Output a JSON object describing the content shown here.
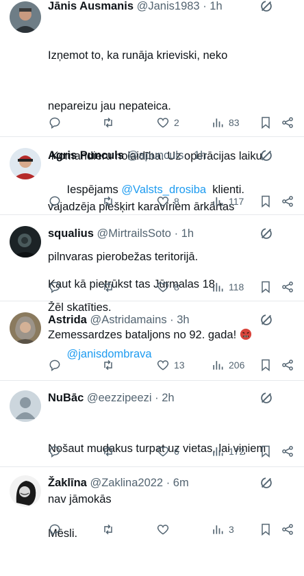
{
  "tweets": [
    {
      "name": "Jānis Ausmanis",
      "handle": "@Janis1983",
      "time": "· 1h",
      "lines": [
        "Izņemot to, ka runāja krieviski, neko",
        "nepareizu jau nepateica.",
        " Komandieru nolaidība. Uz operācijas laiku",
        "vajadzēja piešķirt karavīriem ārkārtas",
        "pilnvaras pierobežas teritorijā.",
        "Žēl skatīties."
      ],
      "likes": "2",
      "views": "83",
      "avatar_colors": {
        "bg": "#6e7d86",
        "skin": "#c89a80",
        "shirt": "#2c3338"
      }
    },
    {
      "name": "Agris Punculs",
      "handle": "@apunculs",
      "time": "· 1h",
      "text_prefix": "Iespējams ",
      "mention": "@Valsts_drosiba",
      "text_suffix": "  klienti.",
      "likes": "8",
      "views": "117",
      "avatar_colors": {
        "bg": "#dfe8f0",
        "skin": "#d7a98c",
        "shirt": "#b52b2b"
      }
    },
    {
      "name": "squalius",
      "handle": "@MirtrailsSoto",
      "time": "· 1h",
      "lines": [
        "Kaut kā pietrūkst tas Jūrmalas 18.",
        "Zemessardzes bataljons no 92. gada! "
      ],
      "emoji": "angry-face",
      "likes": "8",
      "views": "118",
      "avatar_colors": {
        "bg": "#1c2326",
        "skin": "#4a5a5c",
        "shirt": "#0e1214"
      }
    },
    {
      "name": "Astrida",
      "handle": "@Astridamains",
      "time": "· 3h",
      "mention_line": "@janisdombrava",
      "likes": "13",
      "views": "206",
      "avatar_colors": {
        "bg": "#8a7a5e",
        "skin": "#d4b196",
        "shirt": "#5a5246"
      }
    },
    {
      "name": "NuBāc",
      "handle": "@eezzipeezi",
      "time": "· 2h",
      "lines": [
        "Nošaut mudakus turpat uz vietas, lai viņiem",
        "nav jāmokās"
      ],
      "likes": "6",
      "views": "172",
      "avatar_colors": {
        "bg": "#ccd6dd",
        "skin": "#8a98a2",
        "shirt": "#8a98a2"
      }
    },
    {
      "name": "Žaklīna",
      "handle": "@Zaklina2022",
      "time": "· 6m",
      "lines": [
        "Mēsli."
      ],
      "likes": "",
      "views": "3",
      "avatar_colors": {
        "bg": "#f2f2f2",
        "skin": "#d9d9d9",
        "shirt": "#1a1a1a"
      }
    }
  ],
  "icons": [
    "reply-icon",
    "retweet-icon",
    "like-icon",
    "views-icon",
    "bookmark-icon",
    "share-icon",
    "grok-icon",
    "more-icon"
  ],
  "colors": {
    "text": "#0f1419",
    "muted": "#536471",
    "link": "#1d9bf0",
    "divider": "#e6e9ec"
  }
}
